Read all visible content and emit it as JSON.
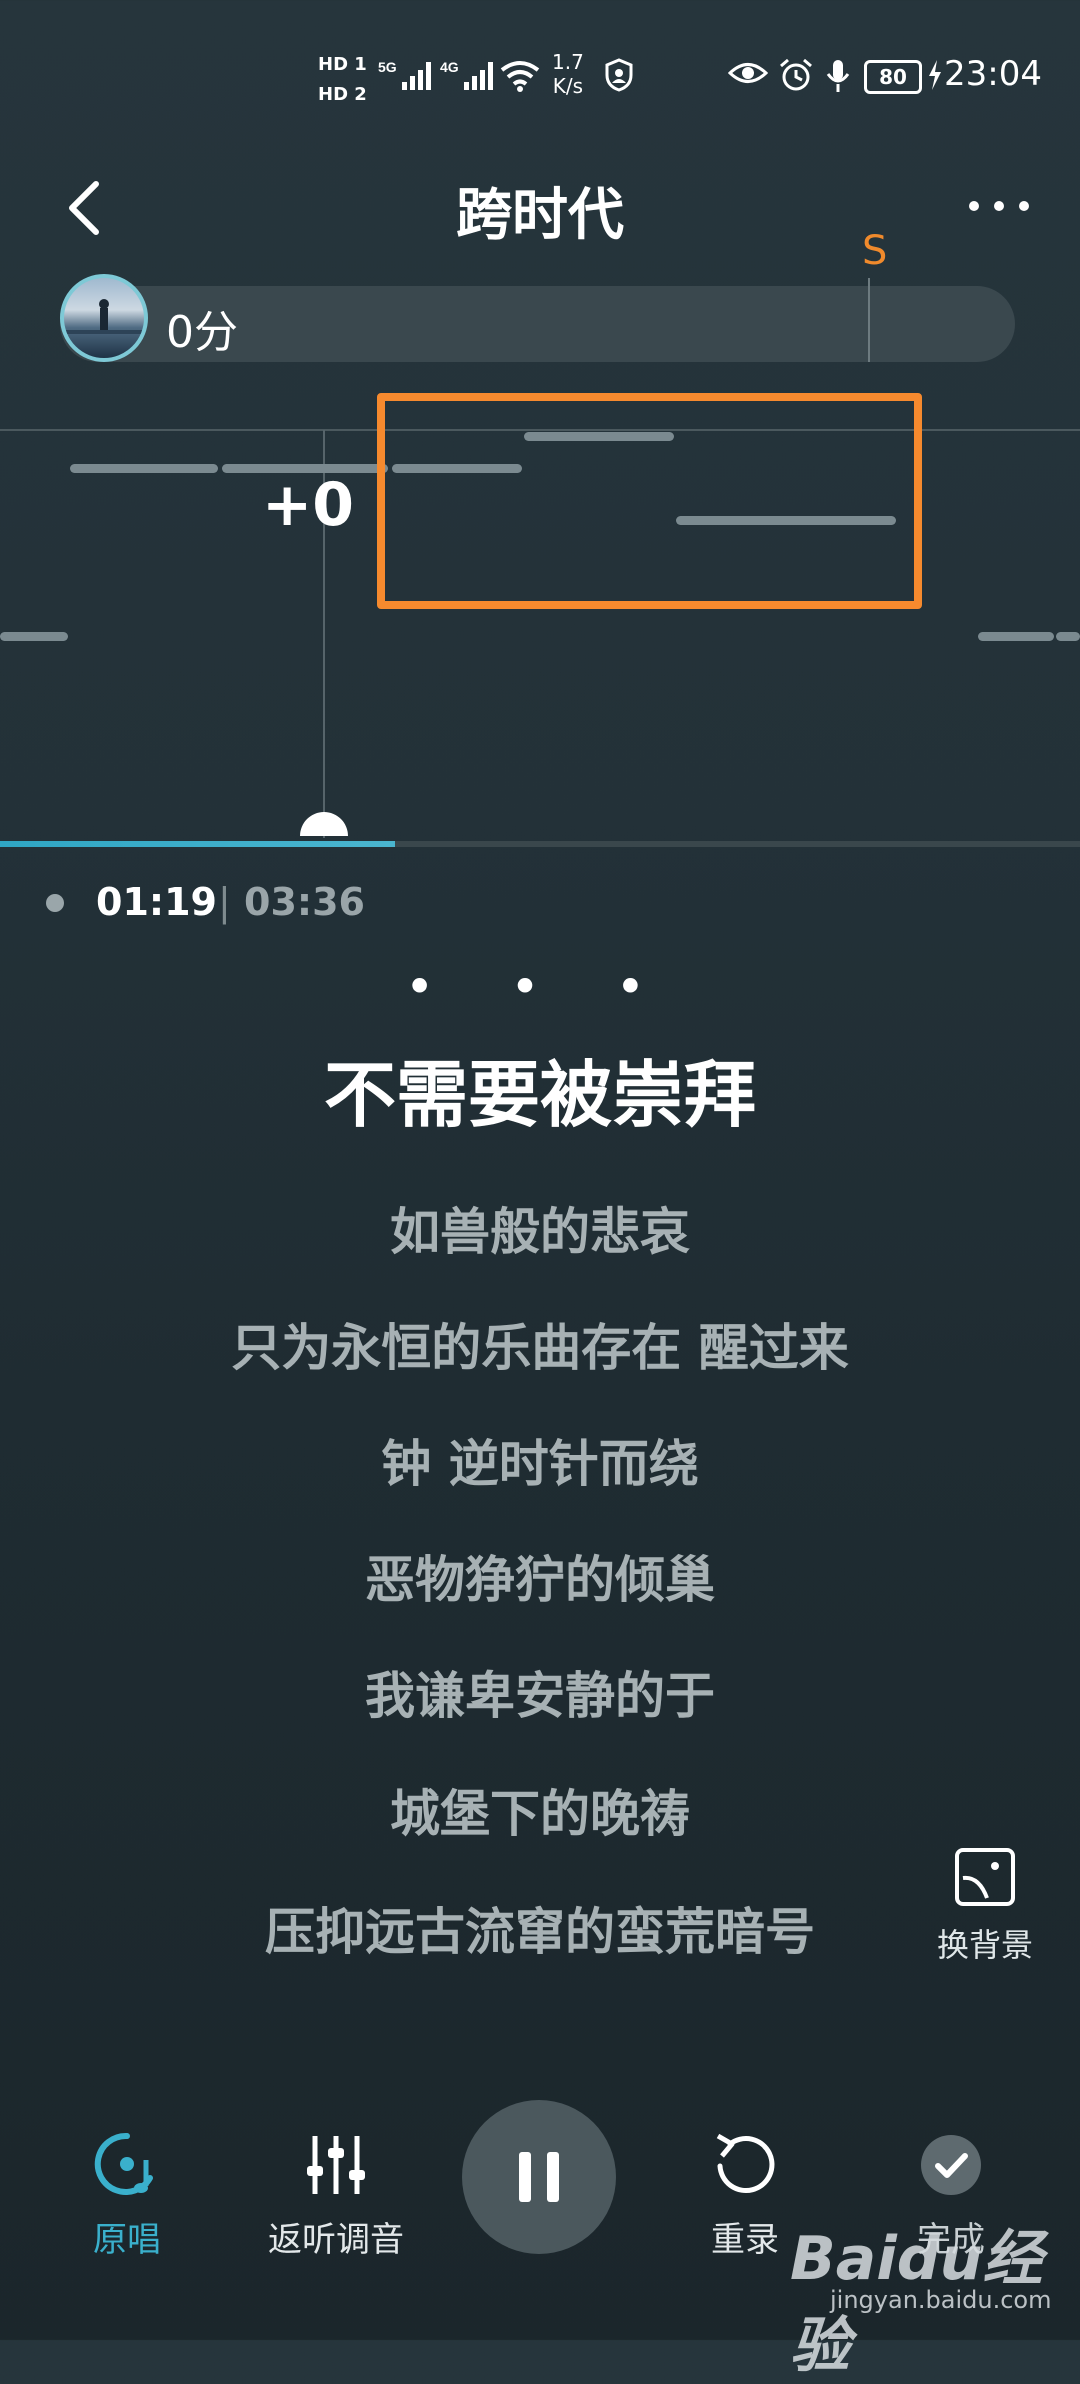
{
  "status_bar": {
    "hd1": "HD 1",
    "hd2": "HD 2",
    "net1": "5G",
    "net2": "4G",
    "speed_value": "1.7",
    "speed_unit": "K/s",
    "battery": "80",
    "time": "23:04"
  },
  "header": {
    "title": "跨时代"
  },
  "score": {
    "value": "0分",
    "marker": "S"
  },
  "pitch": {
    "delta": "+0"
  },
  "playback": {
    "current": "01:19",
    "separator": "|",
    "total": "03:36",
    "progress_fraction": 0.366
  },
  "lyrics": {
    "ellipsis": "• • •",
    "current": "不需要被崇拜",
    "lines": [
      "如兽般的悲哀",
      "只为永恒的乐曲存在 醒过来",
      "钟 逆时针而绕",
      "恶物狰狞的倾巢",
      "我谦卑安静的于",
      "城堡下的晚祷",
      "压抑远古流窜的蛮荒暗号"
    ]
  },
  "side": {
    "change_bg": "换背景"
  },
  "bottom": {
    "original": "原唱",
    "tune": "返听调音",
    "rerecord": "重录",
    "done": "完成"
  },
  "watermark": {
    "brand": "Baidu经验",
    "url": "jingyan.baidu.com"
  },
  "colors": {
    "accent": "#2fa6c4",
    "highlight": "#f68a2e"
  }
}
